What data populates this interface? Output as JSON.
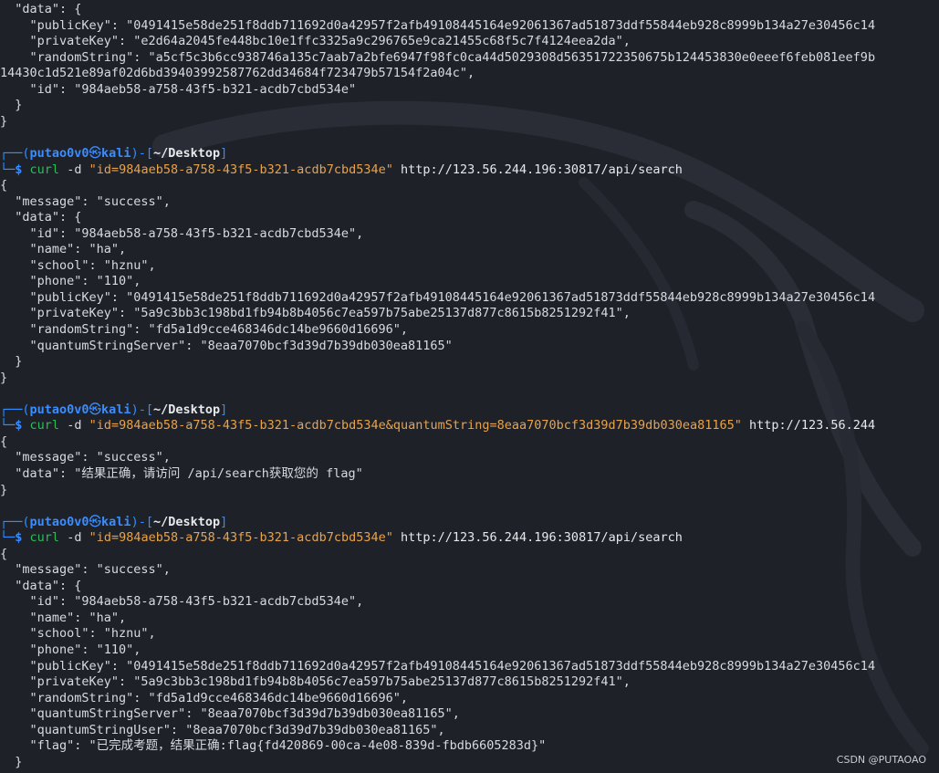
{
  "colors": {
    "background": "#1f2129",
    "prompt_blue": "#3a8dff",
    "command_green": "#2dbb5a",
    "string_orange": "#e8a34a",
    "text": "#d7dae0"
  },
  "icons": {
    "background": "kali-dragon-logo",
    "prompt_symbol": "skull-icon"
  },
  "prompt": {
    "frame_open": "┌──(",
    "user": "putao0v0",
    "at_symbol": "㉿",
    "host": "kali",
    "mid": ")-[",
    "dir": "~/Desktop",
    "frame_close": "]",
    "arrow": "└─",
    "dollar": "$"
  },
  "lines": [
    {
      "kind": "output",
      "text": "  \"data\": {"
    },
    {
      "kind": "output",
      "text": "    \"publicKey\": \"0491415e58de251f8ddb711692d0a42957f2afb49108445164e92061367ad51873ddf55844eb928c8999b134a27e30456c14"
    },
    {
      "kind": "output",
      "text": "    \"privateKey\": \"e2d64a2045fe448bc10e1ffc3325a9c296765e9ca21455c68f5c7f4124eea2da\","
    },
    {
      "kind": "output",
      "text": "    \"randomString\": \"a5cf5c3b6cc938746a135c7aab7a2bfe6947f98fc0ca44d5029308d56351722350675b124453830e0eeef6feb081eef9b"
    },
    {
      "kind": "output",
      "text": "14430c1d521e89af02d6bd39403992587762dd34684f723479b57154f2a04c\","
    },
    {
      "kind": "output",
      "text": "    \"id\": \"984aeb58-a758-43f5-b321-acdb7cbd534e\""
    },
    {
      "kind": "output",
      "text": "  }"
    },
    {
      "kind": "output",
      "text": "}"
    },
    {
      "kind": "blank"
    },
    {
      "kind": "prompt1"
    },
    {
      "kind": "command",
      "cmd": "curl",
      "flag": "-d",
      "arg": "\"id=984aeb58-a758-43f5-b321-acdb7cbd534e\"",
      "url": "http://123.56.244.196:30817/api/search"
    },
    {
      "kind": "output",
      "text": "{"
    },
    {
      "kind": "output",
      "text": "  \"message\": \"success\","
    },
    {
      "kind": "output",
      "text": "  \"data\": {"
    },
    {
      "kind": "output",
      "text": "    \"id\": \"984aeb58-a758-43f5-b321-acdb7cbd534e\","
    },
    {
      "kind": "output",
      "text": "    \"name\": \"ha\","
    },
    {
      "kind": "output",
      "text": "    \"school\": \"hznu\","
    },
    {
      "kind": "output",
      "text": "    \"phone\": \"110\","
    },
    {
      "kind": "output",
      "text": "    \"publicKey\": \"0491415e58de251f8ddb711692d0a42957f2afb49108445164e92061367ad51873ddf55844eb928c8999b134a27e30456c14"
    },
    {
      "kind": "output",
      "text": "    \"privateKey\": \"5a9c3bb3c198bd1fb94b8b4056c7ea597b75abe25137d877c8615b8251292f41\","
    },
    {
      "kind": "output",
      "text": "    \"randomString\": \"fd5a1d9cce468346dc14be9660d16696\","
    },
    {
      "kind": "output",
      "text": "    \"quantumStringServer\": \"8eaa7070bcf3d39d7b39db030ea81165\""
    },
    {
      "kind": "output",
      "text": "  }"
    },
    {
      "kind": "output",
      "text": "}"
    },
    {
      "kind": "blank"
    },
    {
      "kind": "prompt1"
    },
    {
      "kind": "command",
      "cmd": "curl",
      "flag": "-d",
      "arg": "\"id=984aeb58-a758-43f5-b321-acdb7cbd534e&quantumString=8eaa7070bcf3d39d7b39db030ea81165\"",
      "url": "http://123.56.244"
    },
    {
      "kind": "output",
      "text": "{"
    },
    {
      "kind": "output",
      "text": "  \"message\": \"success\","
    },
    {
      "kind": "output",
      "text": "  \"data\": \"结果正确，请访问 /api/search获取您的 flag\""
    },
    {
      "kind": "output",
      "text": "}"
    },
    {
      "kind": "blank"
    },
    {
      "kind": "prompt1"
    },
    {
      "kind": "command",
      "cmd": "curl",
      "flag": "-d",
      "arg": "\"id=984aeb58-a758-43f5-b321-acdb7cbd534e\"",
      "url": "http://123.56.244.196:30817/api/search"
    },
    {
      "kind": "output",
      "text": "{"
    },
    {
      "kind": "output",
      "text": "  \"message\": \"success\","
    },
    {
      "kind": "output",
      "text": "  \"data\": {"
    },
    {
      "kind": "output",
      "text": "    \"id\": \"984aeb58-a758-43f5-b321-acdb7cbd534e\","
    },
    {
      "kind": "output",
      "text": "    \"name\": \"ha\","
    },
    {
      "kind": "output",
      "text": "    \"school\": \"hznu\","
    },
    {
      "kind": "output",
      "text": "    \"phone\": \"110\","
    },
    {
      "kind": "output",
      "text": "    \"publicKey\": \"0491415e58de251f8ddb711692d0a42957f2afb49108445164e92061367ad51873ddf55844eb928c8999b134a27e30456c14"
    },
    {
      "kind": "output",
      "text": "    \"privateKey\": \"5a9c3bb3c198bd1fb94b8b4056c7ea597b75abe25137d877c8615b8251292f41\","
    },
    {
      "kind": "output",
      "text": "    \"randomString\": \"fd5a1d9cce468346dc14be9660d16696\","
    },
    {
      "kind": "output",
      "text": "    \"quantumStringServer\": \"8eaa7070bcf3d39d7b39db030ea81165\","
    },
    {
      "kind": "output",
      "text": "    \"quantumStringUser\": \"8eaa7070bcf3d39d7b39db030ea81165\","
    },
    {
      "kind": "output",
      "text": "    \"flag\": \"已完成考题，结果正确:flag{fd420869-00ca-4e08-839d-fbdb6605283d}\""
    },
    {
      "kind": "output",
      "text": "  }"
    }
  ],
  "watermark": "CSDN @PUTAOAO"
}
